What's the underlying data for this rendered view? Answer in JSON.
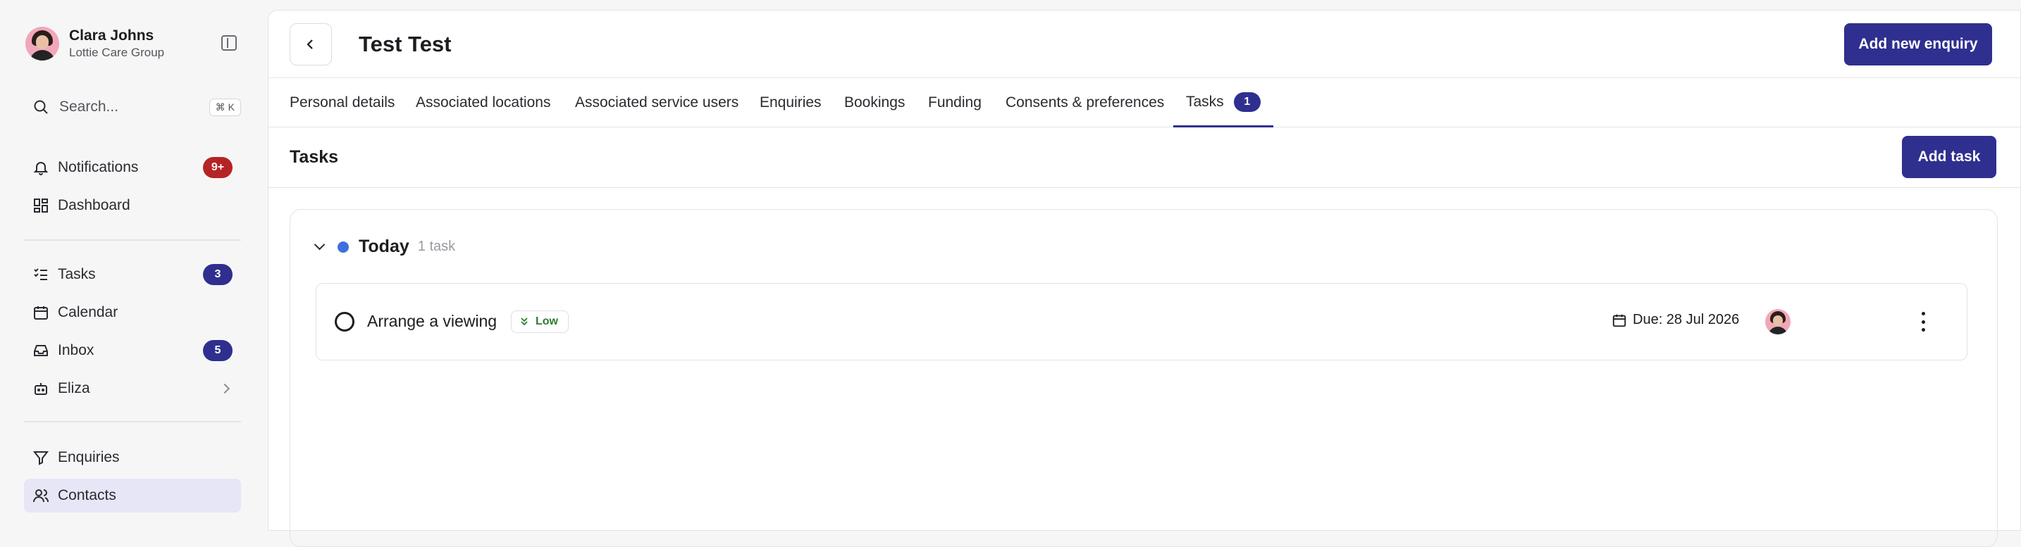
{
  "user": {
    "name": "Clara Johns",
    "org": "Lottie Care Group"
  },
  "search": {
    "placeholder": "Search...",
    "shortcut": "⌘ K"
  },
  "nav": {
    "notifications": {
      "label": "Notifications",
      "badge": "9+"
    },
    "dashboard": {
      "label": "Dashboard"
    },
    "tasks": {
      "label": "Tasks",
      "badge": "3"
    },
    "calendar": {
      "label": "Calendar"
    },
    "inbox": {
      "label": "Inbox",
      "badge": "5"
    },
    "eliza": {
      "label": "Eliza"
    },
    "enquiries": {
      "label": "Enquiries"
    },
    "contacts": {
      "label": "Contacts"
    }
  },
  "header": {
    "title": "Test Test",
    "add_enquiry": "Add new enquiry"
  },
  "tabs": [
    {
      "label": "Personal details"
    },
    {
      "label": "Associated locations"
    },
    {
      "label": "Associated service users"
    },
    {
      "label": "Enquiries"
    },
    {
      "label": "Bookings"
    },
    {
      "label": "Funding"
    },
    {
      "label": "Consents & preferences"
    },
    {
      "label": "Tasks",
      "badge": "1"
    }
  ],
  "section": {
    "title": "Tasks",
    "add_task": "Add task"
  },
  "group": {
    "title": "Today",
    "count": "1 task"
  },
  "task": {
    "title": "Arrange a viewing",
    "priority": "Low",
    "due": "Due: 28 Jul 2026"
  },
  "colors": {
    "accent": "#2f2f8f",
    "danger": "#b52424",
    "today_dot": "#3f6fdf",
    "priority_low": "#2f7a2f"
  }
}
